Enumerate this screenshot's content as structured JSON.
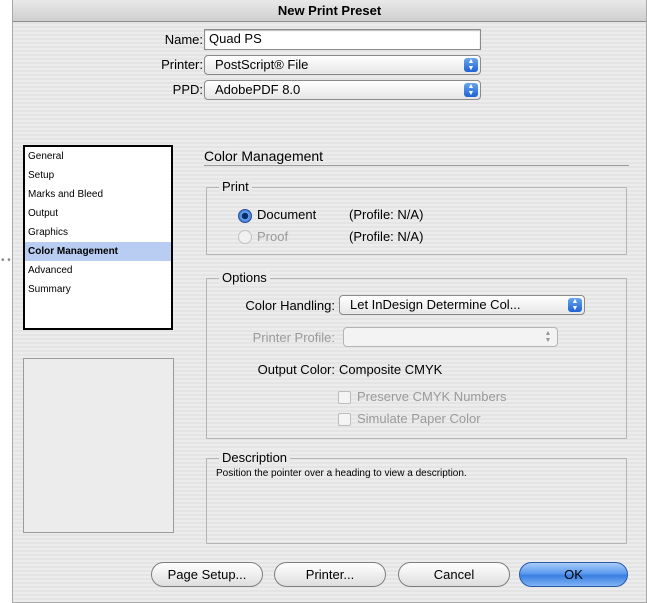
{
  "window": {
    "title": "New Print Preset"
  },
  "form": {
    "name_label": "Name:",
    "name_value": "Quad PS",
    "printer_label": "Printer:",
    "printer_value": "PostScript® File",
    "ppd_label": "PPD:",
    "ppd_value": "AdobePDF 8.0"
  },
  "sidebar": {
    "items": [
      {
        "label": "General"
      },
      {
        "label": "Setup"
      },
      {
        "label": "Marks and Bleed"
      },
      {
        "label": "Output"
      },
      {
        "label": "Graphics"
      },
      {
        "label": "Color Management",
        "selected": true
      },
      {
        "label": "Advanced"
      },
      {
        "label": "Summary"
      }
    ]
  },
  "panel": {
    "title": "Color Management",
    "print_group": {
      "title": "Print",
      "document_label": "Document",
      "document_profile": "(Profile: N/A)",
      "proof_label": "Proof",
      "proof_profile": "(Profile: N/A)",
      "selected": "Document"
    },
    "options_group": {
      "title": "Options",
      "color_handling_label": "Color Handling:",
      "color_handling_value": "Let InDesign Determine Col...",
      "printer_profile_label": "Printer Profile:",
      "printer_profile_value": "",
      "output_color_label": "Output Color:",
      "output_color_value": "Composite CMYK",
      "preserve_cmyk_label": "Preserve CMYK Numbers",
      "simulate_paper_label": "Simulate Paper Color"
    },
    "description": {
      "title": "Description",
      "text": "Position the pointer over a heading to view a description."
    }
  },
  "buttons": {
    "page_setup": "Page Setup...",
    "printer": "Printer...",
    "cancel": "Cancel",
    "ok": "OK"
  },
  "colors": {
    "selection": "#b8cdf1",
    "default_button": "#3a7fe0"
  }
}
